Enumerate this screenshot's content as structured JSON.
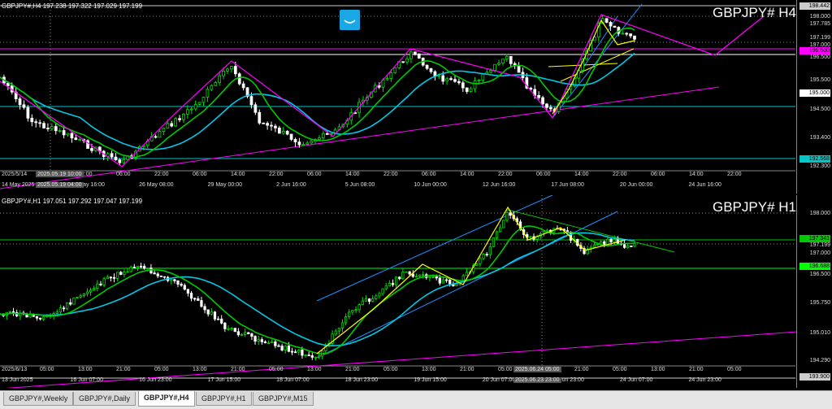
{
  "h4": {
    "header": "GBPJPY#,H4  197.238 197.322 197.029 197.199",
    "title": "GBPJPY#  H4",
    "price_labels": [
      "198.000",
      "197.785",
      "197.199",
      "197.000",
      "196.500",
      "195.500",
      "194.500",
      "193.400",
      "192.300"
    ],
    "price_boxes": [
      {
        "text": "198.442",
        "bg": "#cccccc",
        "fg": "#000000"
      },
      {
        "text": "196.500",
        "bg": "#ff00ff",
        "fg": "#000000"
      },
      {
        "text": "195.000",
        "bg": "#ffffff",
        "fg": "#000000"
      },
      {
        "text": "192.568",
        "bg": "#00c8c8",
        "fg": "#000000"
      }
    ],
    "time_labels": [
      "14 May 2025",
      "21 May 16:00",
      "26 May 08:00",
      "29 May 00:00",
      "2 Jun 16:00",
      "5 Jun 08:00",
      "10 Jun 00:00",
      "12 Jun 16:00",
      "17 Jun 08:00",
      "20 Jun 00:00",
      "24 Jun 16:00"
    ],
    "hour_labels": [
      "2025/5/14",
      "04:00",
      "22:00",
      "06:00",
      "22:00",
      "06:00",
      "14:00",
      "22:00",
      "06:00",
      "14:00",
      "22:00",
      "06:00",
      "14:00",
      "22:00",
      "06:00",
      "14:00",
      "22:00",
      "06:00",
      "14:00",
      "22:00"
    ],
    "cursor_time_top": "2025.05.19 10:00",
    "cursor_time_bottom": "2025.05.19 04:00"
  },
  "h1": {
    "header": "GBPJPY#,H1  197.051 197.292 197.047 197.199",
    "title": "GBPJPY#  H1",
    "price_labels": [
      "198.000",
      "197.199",
      "197.000",
      "196.500",
      "195.750",
      "195.010",
      "194.290"
    ],
    "price_boxes": [
      {
        "text": "197.341",
        "bg": "#00c800",
        "fg": "#000000"
      },
      {
        "text": "196.688",
        "bg": "#00ff00",
        "fg": "#000000"
      },
      {
        "text": "193.900",
        "bg": "#cccccc",
        "fg": "#000000"
      }
    ],
    "time_labels": [
      "13 Jun 2025",
      "16 Jun 07:00",
      "16 Jun 23:00",
      "17 Jun 15:00",
      "18 Jun 07:00",
      "18 Jun 23:00",
      "19 Jun 15:00",
      "20 Jun 07:00",
      "20 Jun 23:00",
      "24 Jun 07:00",
      "24 Jun 23:00"
    ],
    "hour_labels": [
      "2025/6/13",
      "05:00",
      "13:00",
      "21:00",
      "05:00",
      "13:00",
      "21:00",
      "05:00",
      "13:00",
      "21:00",
      "05:00",
      "13:00",
      "21:00",
      "05:00",
      "13:00",
      "21:00",
      "05:00",
      "13:00",
      "21:00",
      "05:00"
    ],
    "cursor_time_top": "2025.06.24 05:00",
    "cursor_time_bottom": "2025.06.23 23:00"
  },
  "tabs": [
    "GBPJPY#,Weekly",
    "GBPJPY#,Daily",
    "GBPJPY#,H4",
    "GBPJPY#,H1",
    "GBPJPY#,M15"
  ],
  "active_tab": "GBPJPY#,H4",
  "colors": {
    "bull": "#00e000",
    "bear": "#ffffff",
    "ma_fast": "#00c800",
    "ma_slow": "#00c8e6",
    "zigzag": "#ff00ff",
    "channel": "#1e90ff",
    "fib": "#ffff00"
  },
  "icon": "smile-indicator-icon"
}
